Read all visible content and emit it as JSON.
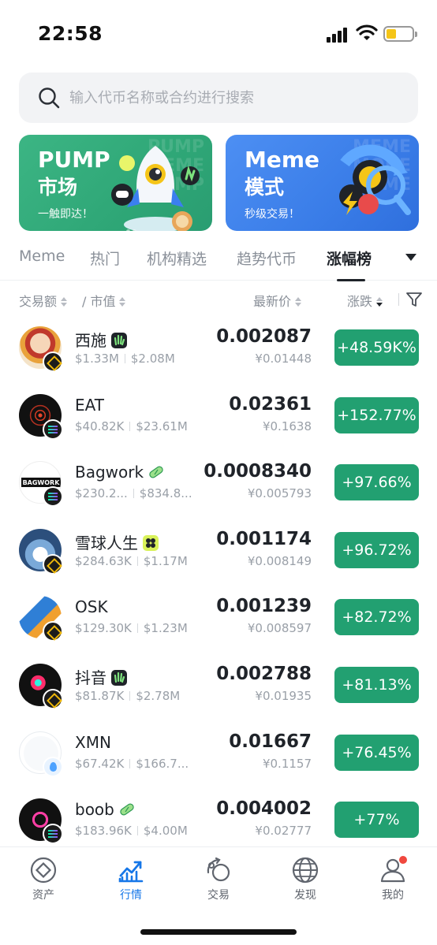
{
  "status_bar": {
    "time": "22:58"
  },
  "search": {
    "placeholder": "输入代币名称或合约进行搜索"
  },
  "banners": [
    {
      "title": "PUMP",
      "title2": "市场",
      "subtitle": "一触即达！"
    },
    {
      "title": "Meme",
      "title2": "模式",
      "subtitle": "秒级交易！"
    }
  ],
  "tabs": [
    {
      "label": "Meme"
    },
    {
      "label": "热门"
    },
    {
      "label": "机构精选"
    },
    {
      "label": "趋势代币"
    },
    {
      "label": "涨幅榜",
      "active": true
    }
  ],
  "columns": {
    "volume": "交易额",
    "market_cap": "/ 市值",
    "price": "最新价",
    "change": "涨跌"
  },
  "rows": [
    {
      "name": "西施",
      "chain": "bnb",
      "badge": "hand-icon",
      "volume": "$1.33M",
      "market_cap": "$2.08M",
      "price": "0.002087",
      "price_cny": "¥0.01448",
      "change": "+48.59K%"
    },
    {
      "name": "EAT",
      "chain": "sol",
      "badge": "",
      "volume": "$40.82K",
      "market_cap": "$23.61M",
      "price": "0.02361",
      "price_cny": "¥0.1638",
      "change": "+152.77%"
    },
    {
      "name": "Bagwork",
      "chain": "sol",
      "badge": "pill-icon",
      "volume": "$230.2...",
      "market_cap": "$834.8...",
      "price": "0.0008340",
      "price_cny": "¥0.005793",
      "change": "+97.66%"
    },
    {
      "name": "雪球人生",
      "chain": "bnb",
      "badge": "four-leaf-icon",
      "volume": "$284.63K",
      "market_cap": "$1.17M",
      "price": "0.001174",
      "price_cny": "¥0.008149",
      "change": "+96.72%"
    },
    {
      "name": "OSK",
      "chain": "bnb",
      "badge": "",
      "volume": "$129.30K",
      "market_cap": "$1.23M",
      "price": "0.001239",
      "price_cny": "¥0.008597",
      "change": "+82.72%"
    },
    {
      "name": "抖音",
      "chain": "bnb",
      "badge": "hand-icon",
      "volume": "$81.87K",
      "market_cap": "$2.78M",
      "price": "0.002788",
      "price_cny": "¥0.01935",
      "change": "+81.13%"
    },
    {
      "name": "XMN",
      "chain": "sui",
      "badge": "",
      "volume": "$67.42K",
      "market_cap": "$166.7...",
      "price": "0.01667",
      "price_cny": "¥0.1157",
      "change": "+76.45%"
    },
    {
      "name": "boob",
      "chain": "sol",
      "badge": "pill-icon",
      "volume": "$183.96K",
      "market_cap": "$4.00M",
      "price": "0.004002",
      "price_cny": "¥0.02777",
      "change": "+77%"
    }
  ],
  "nav": [
    {
      "label": "资产",
      "icon": "assets-icon"
    },
    {
      "label": "行情",
      "icon": "market-chart-icon",
      "active": true
    },
    {
      "label": "交易",
      "icon": "trade-icon"
    },
    {
      "label": "发现",
      "icon": "globe-icon"
    },
    {
      "label": "我的",
      "icon": "profile-icon"
    }
  ],
  "colors": {
    "up_green": "#22a071",
    "accent_blue": "#1677e8",
    "pump_banner": "#2fa777",
    "meme_banner": "#3a7de8"
  }
}
